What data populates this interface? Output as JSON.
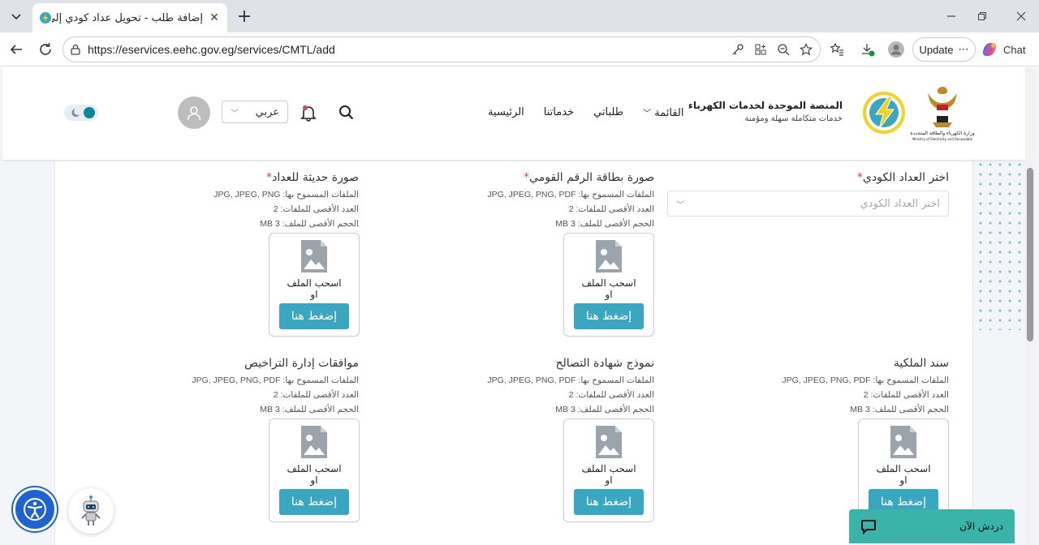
{
  "browser": {
    "tab_title": "إضافة طلب - تحويل عداد كودي إلى",
    "url": "https://eservices.eehc.gov.eg/services/CMTL/add",
    "update_label": "Update",
    "chat_label": "Chat"
  },
  "header": {
    "brand_title": "المنصة الموحدة لخدمات الكهرباء",
    "brand_subtitle": "خدمات متكاملة سهلة ومؤمنة",
    "nav": [
      "الرئيسية",
      "خدماتنا",
      "طلباتي",
      "القائمة"
    ],
    "language": "عربي"
  },
  "form": {
    "meter_label": "اختر العداد الكودي",
    "meter_placeholder": "اختر العداد الكودي",
    "drag_text": "اسحب الملف",
    "or_text": "او",
    "browse_label": "إضغط هنا",
    "uploads": [
      {
        "label": "صورة بطاقة الرقم القومي",
        "required": "*",
        "types": "الملفات المسموح بها: JPG, JPEG, PNG, PDF",
        "max_files": "العدد الأقصى للملفات: 2",
        "max_size": "الحجم الأقصى للملف: 3 MB"
      },
      {
        "label": "صورة حديثة للعداد",
        "required": "*",
        "types": "الملفات المسموح بها: JPG, JPEG, PNG",
        "max_files": "العدد الأقصى للملفات: 2",
        "max_size": "الحجم الأقصى للملف: 3 MB"
      },
      {
        "label": "سند الملكية",
        "required": "",
        "types": "الملفات المسموح بها: JPG, JPEG, PNG, PDF",
        "max_files": "العدد الأقصى للملفات: 2",
        "max_size": "الحجم الأقصى للملف: 3 MB"
      },
      {
        "label": "نموذج شهادة التصالح",
        "required": "",
        "types": "الملفات المسموح بها: JPG, JPEG, PNG, PDF",
        "max_files": "العدد الأقصى للملفات: 2",
        "max_size": "الحجم الأقصى للملف: 3 MB"
      },
      {
        "label": "موافقات إدارة التراخيص",
        "required": "",
        "types": "الملفات المسموح بها: JPG, JPEG, PNG, PDF",
        "max_files": "العدد الأقصى للملفات: 2",
        "max_size": "الحجم الأقصى للملف: 3 MB"
      }
    ]
  },
  "chat_widget": {
    "label": "دردش الآن"
  },
  "colors": {
    "accent": "#3aa6bf",
    "chat": "#3ab3a8",
    "a11y": "#1d63d6"
  }
}
